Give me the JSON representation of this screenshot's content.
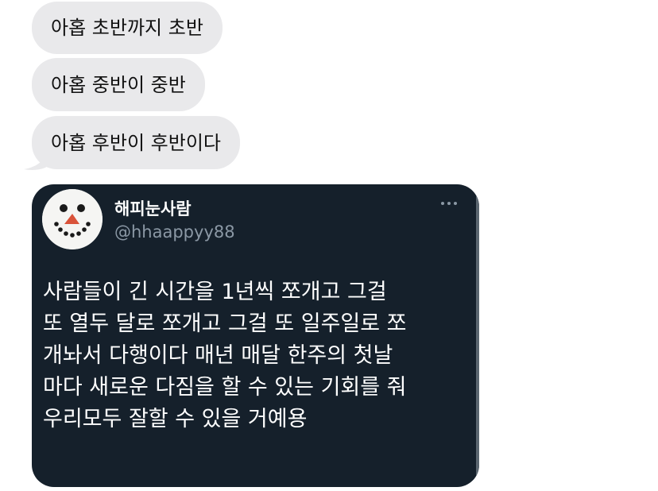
{
  "messages": [
    {
      "text": "아홉 초반까지 초반"
    },
    {
      "text": "아홉 중반이 중반"
    },
    {
      "text": "아홉 후반이 후반이다"
    }
  ],
  "tweet": {
    "display_name": "해피눈사람",
    "handle": "@hhaappyy88",
    "lines": [
      "사람들이 긴 시간을 1년씩 쪼개고 그걸",
      "또 열두 달로 쪼개고 그걸 또 일주일로 쪼",
      "개놔서 다행이다 매년 매달 한주의 첫날",
      "마다 새로운 다짐을 할 수 있는 기회를 줘",
      "우리모두 잘할 수 있을 거예용"
    ],
    "avatar_icon": "snowman-face-icon",
    "more_icon": "more-horizontal-icon"
  },
  "colors": {
    "bubble_bg": "#e9e9eb",
    "card_bg": "#15202b",
    "handle": "#8b98a5"
  }
}
